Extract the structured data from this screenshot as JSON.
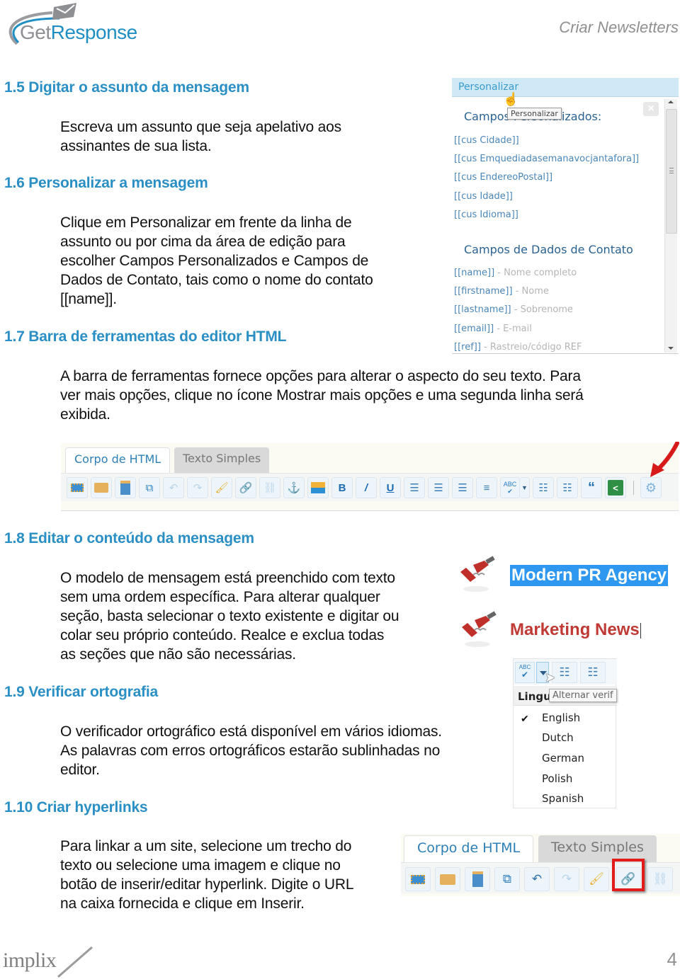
{
  "header": {
    "logo": {
      "part1": "Get",
      "part2": "Response"
    },
    "title": "Criar Newsletters"
  },
  "sections": [
    {
      "heading": "1.5 Digitar o assunto da mensagem",
      "body": [
        "Escreva um assunto que seja apelativo aos",
        "assinantes de sua lista."
      ]
    },
    {
      "heading": "1.6 Personalizar a mensagem",
      "body": [
        "Clique em Personalizar em frente da linha de",
        "assunto ou por cima da área de edição para",
        "escolher Campos Personalizados e Campos de",
        "Dados de Contato, tais como o nome do contato",
        "[[name]]."
      ]
    },
    {
      "heading": "1.7 Barra de ferramentas do editor HTML",
      "body": [
        " A barra de ferramentas fornece opções para alterar o aspecto do seu texto. Para",
        "ver mais opções, clique no ícone Mostrar mais opções e uma segunda linha será",
        "exibida."
      ]
    },
    {
      "heading": "1.8 Editar o conteúdo da mensagem",
      "body": [
        "O modelo de mensagem está preenchido com texto",
        "sem uma ordem específica. Para alterar qualquer",
        "seção, basta selecionar o texto existente e digitar ou",
        "colar seu próprio conteúdo. Realce e exclua todas",
        "as seções que não são necessárias."
      ]
    },
    {
      "heading": "1.9 Verificar ortografia",
      "body": [
        "O verificador ortográfico está disponível em vários idiomas.",
        "As palavras com erros ortográficos estarão sublinhadas no",
        "editor."
      ]
    },
    {
      "heading": "1.10 Criar hyperlinks",
      "body": [
        "Para linkar a um site, selecione um trecho do",
        "texto ou selecione uma imagem e clique no",
        "botão de inserir/editar hyperlink. Digite o URL",
        "na caixa fornecida e clique em Inserir."
      ]
    }
  ],
  "personalize_panel": {
    "bar_label": "Personalizar",
    "tooltip": "Personalizar",
    "custom_heading": "Campos Personalizados:",
    "custom_fields": [
      "[[cus Cidade]]",
      "[[cus Emquediadasemanavocjantafora]]",
      "[[cus EndereoPostal]]",
      "[[cus Idade]]",
      "[[cus Idioma]]"
    ],
    "contact_heading": "Campos de Dados de Contato",
    "contact_fields": [
      {
        "tag": "[[name]]",
        "desc": " - Nome completo"
      },
      {
        "tag": "[[firstname]]",
        "desc": " - Nome"
      },
      {
        "tag": "[[lastname]]",
        "desc": " - Sobrenome"
      },
      {
        "tag": "[[email]]",
        "desc": " - E-mail"
      },
      {
        "tag": "[[ref]]",
        "desc": " - Rastreio/código REF"
      }
    ],
    "close_icon": "×"
  },
  "editor_toolbar": {
    "tabs": [
      "Corpo de HTML",
      "Texto Simples"
    ],
    "active_tab": "Corpo de HTML",
    "buttons": [
      "fullscreen",
      "templates",
      "blocks",
      "paste",
      "undo",
      "redo",
      "clean",
      "link",
      "unlink",
      "anchor",
      "image",
      "bold",
      "italic",
      "underline",
      "align-left",
      "align-center",
      "align-right",
      "justify",
      "spellcheck",
      "spellcheck-dropdown",
      "bullet-list",
      "numbered-list",
      "blockquote",
      "share",
      "more-options"
    ]
  },
  "template_preview": {
    "title1": "Modern PR Agency",
    "title2": "Marketing News"
  },
  "spell_menu": {
    "abc": "ABC",
    "header": "Lingu",
    "tooltip": "Alternar verif",
    "languages": [
      "English",
      "Dutch",
      "German",
      "Polish",
      "Spanish"
    ],
    "selected": "English",
    "check": "✔"
  },
  "hyperlink_toolbar": {
    "tabs": [
      "Corpo de HTML",
      "Texto Simples"
    ],
    "highlighted_button": "insert-edit-link"
  },
  "footer": {
    "brand": "implix",
    "page_number": "4"
  }
}
